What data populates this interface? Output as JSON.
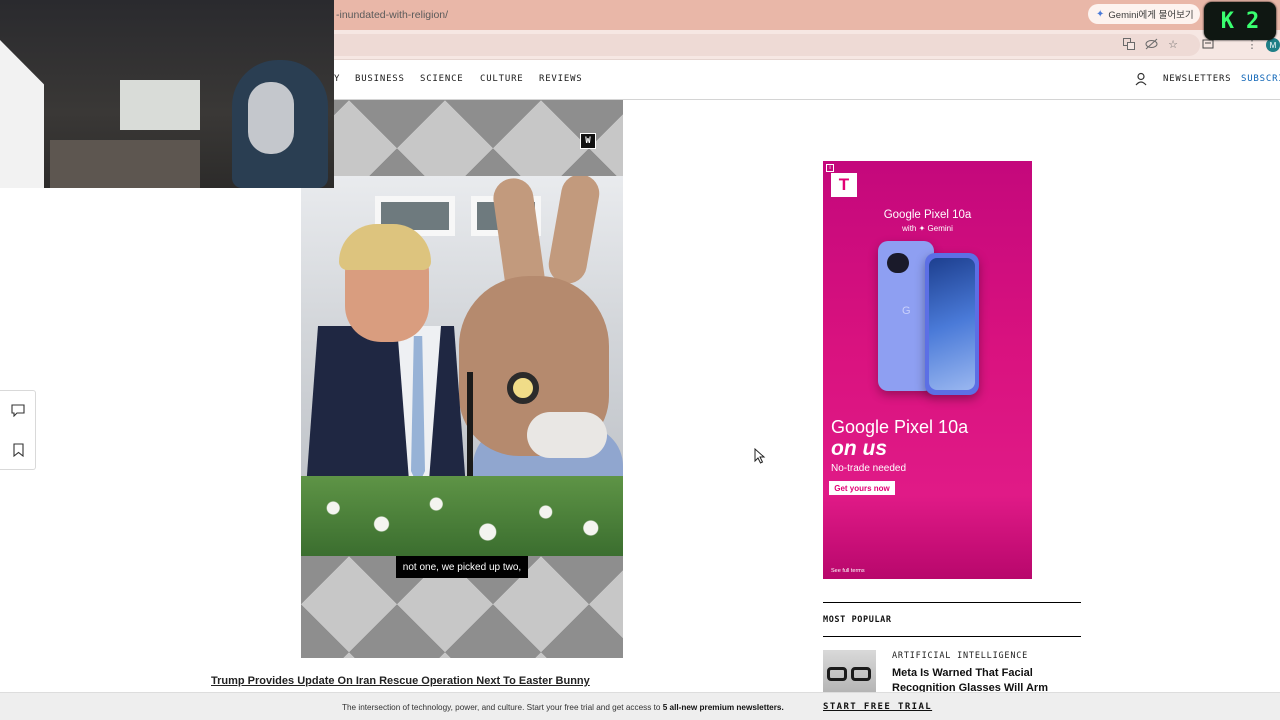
{
  "browser": {
    "url": "-inundated-with-religion/",
    "gemini_button": "Gemini에게 물어보기",
    "profile_initial": "M"
  },
  "overlay": {
    "k2_badge": [
      "K",
      "2"
    ]
  },
  "nav": {
    "items": [
      "BUSINESS",
      "SCIENCE",
      "CULTURE",
      "REVIEWS"
    ],
    "newsletters": "NEWSLETTERS",
    "subscribe": "SUBSCRI"
  },
  "video": {
    "caption_top": "we picked up two,",
    "caption_bottom": "not one, we picked up two,",
    "title": "Trump Provides Update On Iran Rescue Operation Next To Easter Bunny",
    "brand_mark": "W"
  },
  "ad": {
    "logo": "T",
    "headline": "Google Pixel 10a",
    "with_gemini": "with ✦ Gemini",
    "phone_letter": "G",
    "big_line1": "Google Pixel 10a",
    "big_line2": "on us",
    "subline": "No-trade needed",
    "cta": "Get yours now",
    "terms": "See full terms"
  },
  "most_popular": {
    "title": "MOST POPULAR",
    "items": [
      {
        "category": "ARTIFICIAL INTELLIGENCE",
        "headline": "Meta Is Warned That Facial Recognition Glasses Will Arm"
      }
    ]
  },
  "banner": {
    "text": "The intersection of technology, power, and culture. Start your free trial and get access to ",
    "strong": "5 all-new premium newsletters.",
    "cta": "START FREE TRIAL"
  },
  "colors": {
    "tabstrip": "#e9b7a8",
    "tmobile_magenta": "#e20074",
    "subscribe_blue": "#0b63b6"
  }
}
